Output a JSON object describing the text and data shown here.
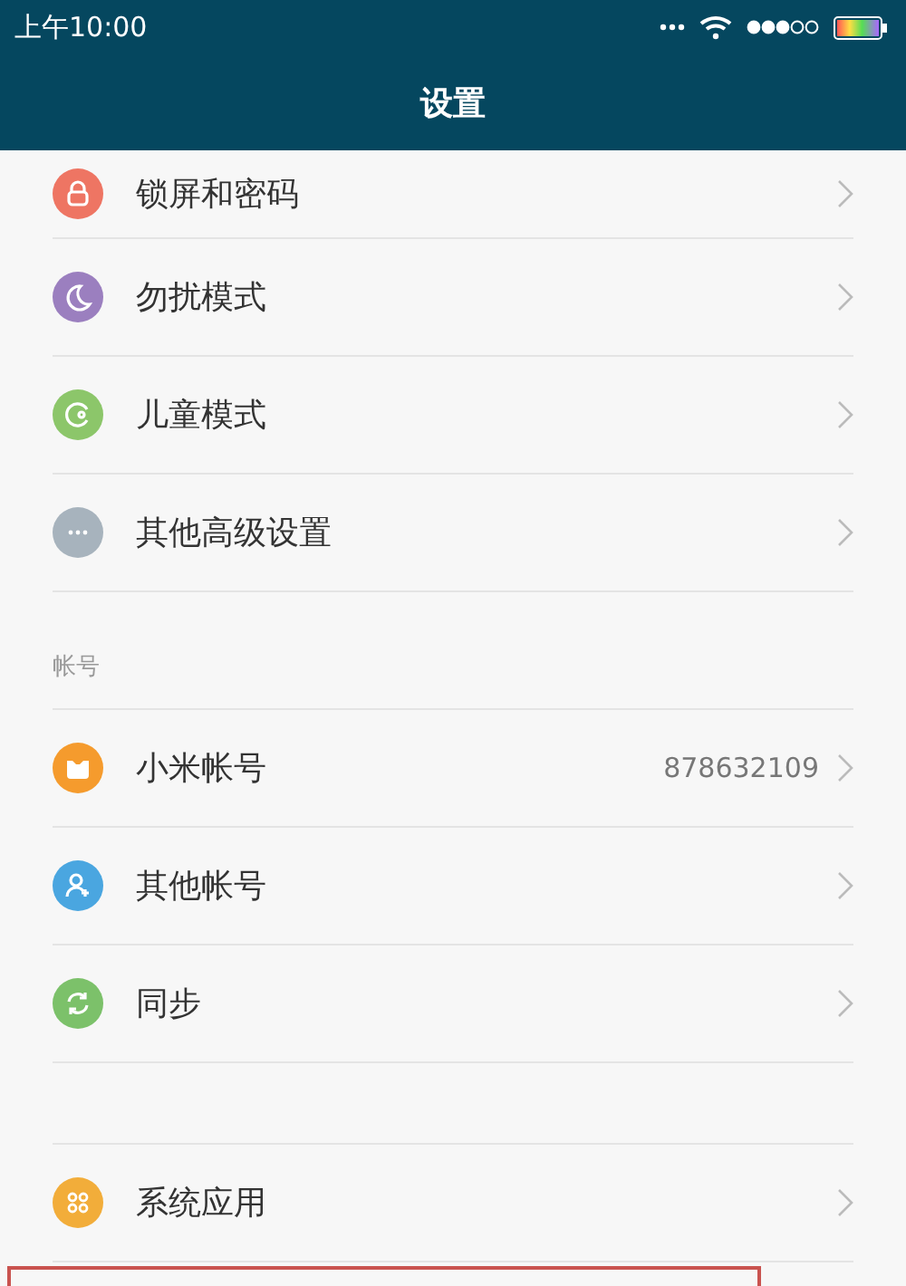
{
  "status_bar": {
    "time": "上午10:00"
  },
  "title": "设置",
  "sections": [
    {
      "items": [
        {
          "label": "锁屏和密码",
          "color": "#ee7563"
        },
        {
          "label": "勿扰模式",
          "color": "#9b7fbf"
        },
        {
          "label": "儿童模式",
          "color": "#8cc66a"
        },
        {
          "label": "其他高级设置",
          "color": "#a7b3bd"
        }
      ]
    },
    {
      "header": "帐号",
      "items": [
        {
          "label": "小米帐号",
          "value": "878632109",
          "color": "#f59b2d"
        },
        {
          "label": "其他帐号",
          "color": "#4aa6e0"
        },
        {
          "label": "同步",
          "color": "#7cc16a"
        }
      ]
    },
    {
      "items": [
        {
          "label": "系统应用",
          "color": "#f2ad3a"
        }
      ]
    }
  ],
  "highlight_frame": {
    "shown": true
  }
}
